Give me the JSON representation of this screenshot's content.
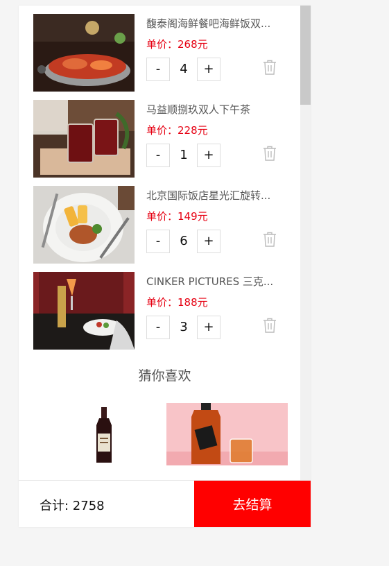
{
  "cart": {
    "price_prefix": "单价：",
    "price_suffix": "元",
    "minus_label": "-",
    "plus_label": "+",
    "items": [
      {
        "title": "馥泰阁海鲜餐吧海鲜饭双...",
        "price": "268",
        "price_text": "单价：268元",
        "quantity": "4",
        "image": "seafood-platter-photo"
      },
      {
        "title": "马益顺捌玖双人下午茶",
        "price": "228",
        "price_text": "单价：228元",
        "quantity": "1",
        "image": "afternoon-tea-drinks-photo"
      },
      {
        "title": "北京国际饭店星光汇旋转...",
        "price": "149",
        "price_text": "单价：149元",
        "quantity": "6",
        "image": "steak-fries-plate-photo"
      },
      {
        "title": "CINKER PICTURES 三克...",
        "price": "188",
        "price_text": "单价：188元",
        "quantity": "3",
        "image": "cocktail-dinner-photo"
      }
    ]
  },
  "recommend": {
    "title": "猜你喜欢",
    "items": [
      {
        "image": "wine-bottle-photo"
      },
      {
        "image": "whisky-glass-photo"
      }
    ]
  },
  "footer": {
    "total_label": "合计: 2758",
    "total_value": "2758",
    "checkout_label": "去结算"
  },
  "colors": {
    "price": "#e60012",
    "checkout_bg": "#ff0000",
    "page_bg": "#f5f5f5"
  },
  "icons": {
    "delete": "trash-icon"
  }
}
